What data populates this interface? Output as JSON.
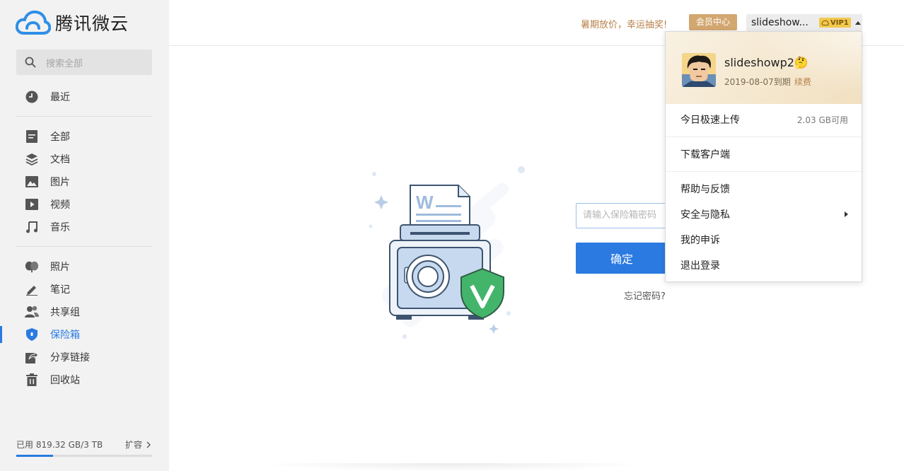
{
  "app": {
    "name": "腾讯微云"
  },
  "search": {
    "placeholder": "搜索全部"
  },
  "sidebar": {
    "recent": "最近",
    "groups": [
      {
        "items": [
          {
            "label": "全部",
            "icon": "file-icon"
          },
          {
            "label": "文档",
            "icon": "layers-icon"
          },
          {
            "label": "图片",
            "icon": "image-icon"
          },
          {
            "label": "视频",
            "icon": "video-icon"
          },
          {
            "label": "音乐",
            "icon": "music-icon"
          }
        ]
      },
      {
        "items": [
          {
            "label": "照片",
            "icon": "photo-icon"
          },
          {
            "label": "笔记",
            "icon": "pen-icon"
          },
          {
            "label": "共享组",
            "icon": "group-icon"
          },
          {
            "label": "保险箱",
            "icon": "shield-icon",
            "active": true
          },
          {
            "label": "分享链接",
            "icon": "share-link-icon"
          },
          {
            "label": "回收站",
            "icon": "trash-icon"
          }
        ]
      }
    ],
    "storage": {
      "used_text": "已用 819.32 GB/3 TB",
      "expand_label": "扩容",
      "used_fraction": 0.27
    }
  },
  "header": {
    "promo": "暑期放价，幸运抽奖!",
    "member_center": "会员中心",
    "username_short": "slideshow...",
    "vip_label": "VIP1"
  },
  "vault": {
    "password_placeholder": "请输入保险箱密码",
    "confirm_label": "确定",
    "forgot_label": "忘记密码?"
  },
  "dropdown": {
    "username": "slideshowp2",
    "emoji": "🤔",
    "expire": "2019-08-07到期",
    "renew": "续费",
    "upload": {
      "label": "今日极速上传",
      "value": "2.03 GB可用"
    },
    "download_client": "下载客户端",
    "help": "帮助与反馈",
    "security": "安全与隐私",
    "appeal": "我的申诉",
    "logout": "退出登录"
  },
  "colors": {
    "accent": "#2a7ae2",
    "gold": "#d2a770",
    "promo": "#b8814a"
  }
}
